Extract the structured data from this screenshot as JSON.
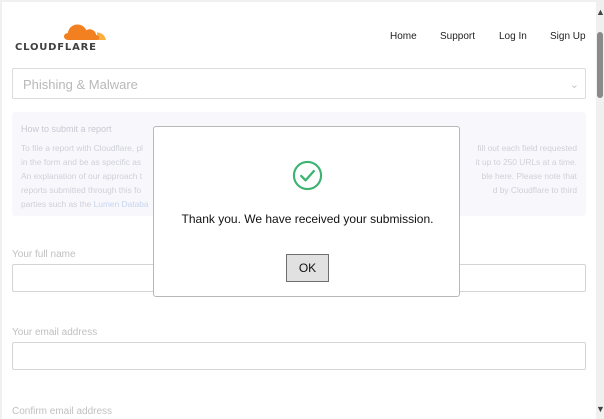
{
  "brand": {
    "name": "CLOUDFLARE",
    "logo_color": "#f38020"
  },
  "nav": {
    "items": [
      "Home",
      "Support",
      "Log In",
      "Sign Up"
    ]
  },
  "form": {
    "report_type": {
      "value": "Phishing & Malware"
    },
    "info": {
      "heading": "How to submit a report",
      "line1a": "To file a report with Cloudflare, pl",
      "line1b": "fill out each field requested",
      "line2a": "in the form and be as specific as",
      "line2b": "it up to 250 URLs at a time.",
      "line3a": "An explanation of our approach t",
      "line3b": "ble here. Please note that",
      "line4a": "reports submitted through this fo",
      "line4b": "d by Cloudflare to third",
      "line5a": "parties such as the ",
      "line5link": "Lumen Databa"
    },
    "full_name_label": "Your full name",
    "email_label": "Your email address",
    "confirm_email_label": "Confirm email address"
  },
  "modal": {
    "message": "Thank you. We have received your submission.",
    "ok_label": "OK",
    "icon": "check-circle-icon",
    "icon_color": "#3cb371"
  }
}
